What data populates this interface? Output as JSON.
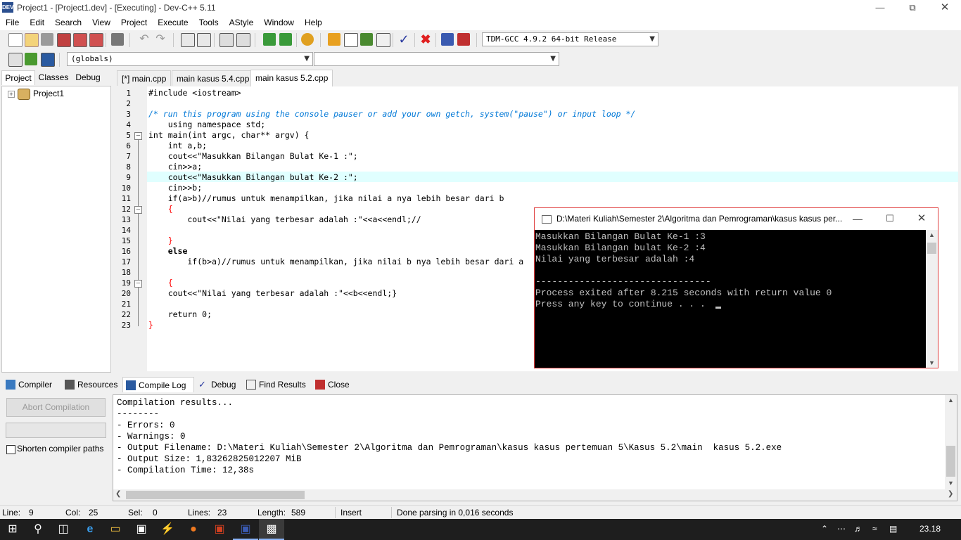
{
  "window": {
    "title": "Project1 - [Project1.dev] - [Executing] - Dev-C++ 5.11",
    "app_icon_text": "DEV"
  },
  "menu": [
    "File",
    "Edit",
    "Search",
    "View",
    "Project",
    "Execute",
    "Tools",
    "AStyle",
    "Window",
    "Help"
  ],
  "toolbar": {
    "compiler_select": "TDM-GCC 4.9.2 64-bit Release",
    "scope_select": "(globals)",
    "member_select": ""
  },
  "left_panel": {
    "tabs": [
      "Project",
      "Classes",
      "Debug"
    ],
    "tree": [
      {
        "label": "Project1",
        "expander": "+"
      }
    ]
  },
  "editor_tabs": [
    "[*] main.cpp",
    "main kasus 5.4.cpp",
    "main  kasus 5.2.cpp"
  ],
  "editor": {
    "current_line": 9,
    "lines": [
      {
        "n": "1",
        "text": "#include <iostream>"
      },
      {
        "n": "2",
        "text": ""
      },
      {
        "n": "3",
        "text": "/* run this program using the console pauser or add your own getch, system(\"pause\") or input loop */"
      },
      {
        "n": "4",
        "text": "    using namespace std;"
      },
      {
        "n": "5",
        "text": "int main(int argc, char** argv) {"
      },
      {
        "n": "6",
        "text": "    int a,b;"
      },
      {
        "n": "7",
        "text": "    cout<<\"Masukkan Bilangan Bulat Ke-1 :\";"
      },
      {
        "n": "8",
        "text": "    cin>>a;"
      },
      {
        "n": "9",
        "text": "    cout<<\"Masukkan Bilangan bulat Ke-2 :\";"
      },
      {
        "n": "10",
        "text": "    cin>>b;"
      },
      {
        "n": "11",
        "text": "    if(a>b)//rumus untuk menampilkan, jika nilai a nya lebih besar dari b"
      },
      {
        "n": "12",
        "text": "    {"
      },
      {
        "n": "13",
        "text": "        cout<<\"Nilai yang terbesar adalah :\"<<a<<endl;//"
      },
      {
        "n": "14",
        "text": ""
      },
      {
        "n": "15",
        "text": "    }"
      },
      {
        "n": "16",
        "text": "    else"
      },
      {
        "n": "17",
        "text": "        if(b>a)//rumus untuk menampilkan, jika nilai b nya lebih besar dari a"
      },
      {
        "n": "18",
        "text": ""
      },
      {
        "n": "19",
        "text": "    {"
      },
      {
        "n": "20",
        "text": "    cout<<\"Nilai yang terbesar adalah :\"<<b<<endl;}"
      },
      {
        "n": "21",
        "text": ""
      },
      {
        "n": "22",
        "text": "    return 0;"
      },
      {
        "n": "23",
        "text": "}"
      }
    ]
  },
  "console": {
    "title": "D:\\Materi Kuliah\\Semester 2\\Algoritma dan Pemrograman\\kasus kasus per...",
    "lines": [
      "Masukkan Bilangan Bulat Ke-1 :3",
      "Masukkan Bilangan bulat Ke-2 :4",
      "Nilai yang terbesar adalah :4",
      "",
      "--------------------------------",
      "Process exited after 8.215 seconds with return value 0",
      "Press any key to continue . . . "
    ]
  },
  "bottom_tabs": [
    "Compiler",
    "Resources",
    "Compile Log",
    "Debug",
    "Find Results",
    "Close"
  ],
  "bottom_left": {
    "abort_button": "Abort Compilation",
    "shorten_paths_label": "Shorten compiler paths",
    "shorten_paths_checked": false
  },
  "compile_log": [
    "Compilation results...",
    "--------",
    "- Errors: 0",
    "- Warnings: 0",
    "- Output Filename: D:\\Materi Kuliah\\Semester 2\\Algoritma dan Pemrograman\\kasus kasus pertemuan 5\\Kasus 5.2\\main  kasus 5.2.exe",
    "- Output Size: 1,83262825012207 MiB",
    "- Compilation Time: 12,38s"
  ],
  "statusbar": {
    "line_label": "Line:",
    "line_value": "9",
    "col_label": "Col:",
    "col_value": "25",
    "sel_label": "Sel:",
    "sel_value": "0",
    "lines_label": "Lines:",
    "lines_value": "23",
    "length_label": "Length:",
    "length_value": "589",
    "mode": "Insert",
    "message": "Done parsing in 0,016 seconds"
  },
  "taskbar": {
    "clock": "23.18"
  },
  "colors": {
    "keyword": "#000000",
    "comment": "#0078d7",
    "string": "#0000ff",
    "operator": "#ff0000",
    "current_line": "#e0ffff",
    "console_bg": "#000000",
    "console_fg": "#c0c0c0"
  }
}
